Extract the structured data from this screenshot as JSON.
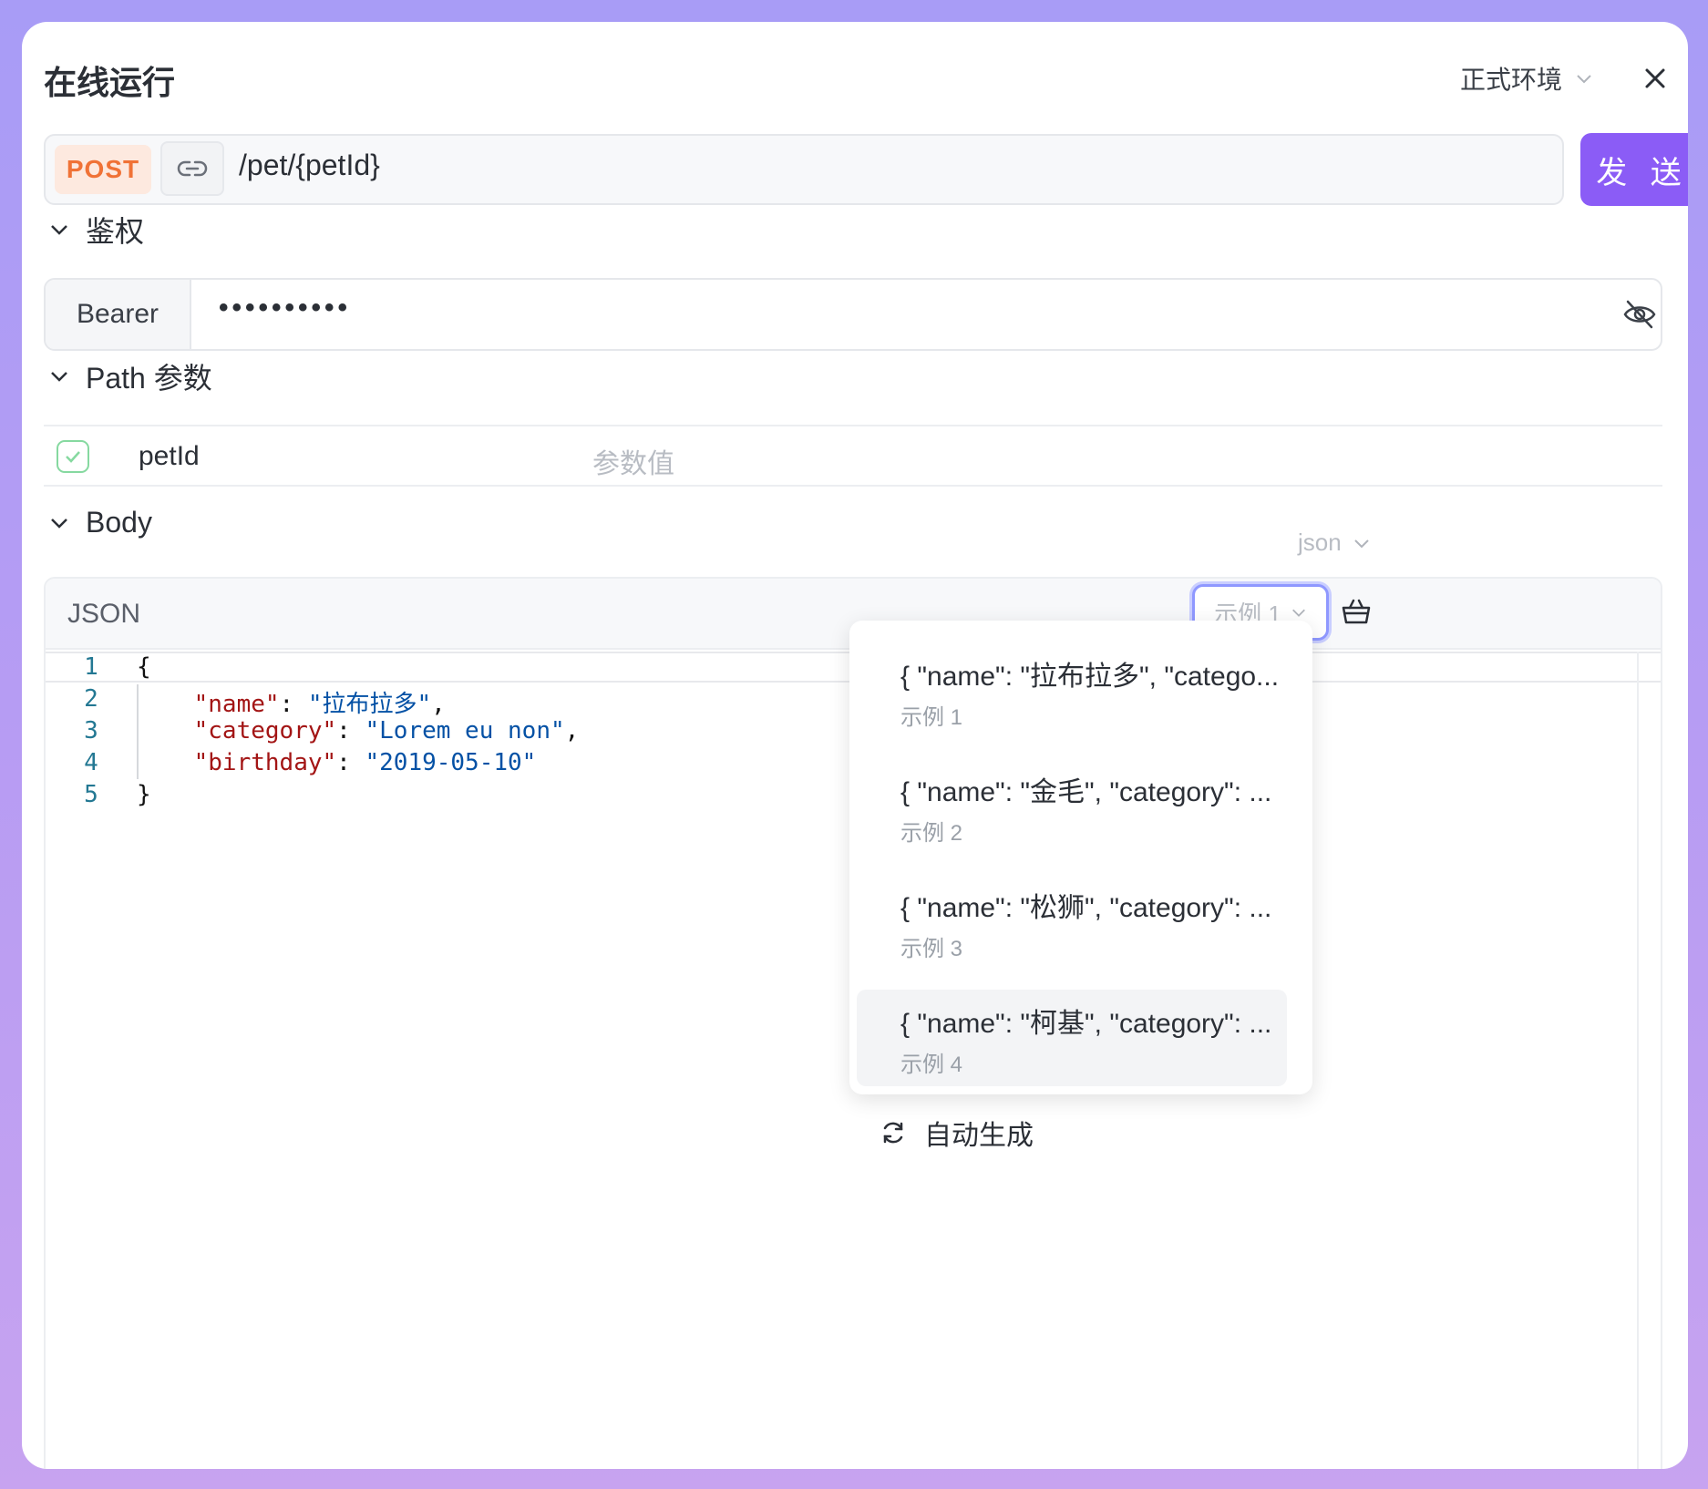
{
  "header": {
    "title": "在线运行",
    "env_label": "正式环境"
  },
  "request": {
    "method": "POST",
    "path": "/pet/{petId}",
    "send_label": "发 送"
  },
  "auth": {
    "section_title": "鉴权",
    "type": "Bearer",
    "token_masked": "••••••••••"
  },
  "path_params": {
    "section_title": "Path 参数",
    "rows": [
      {
        "name": "petId",
        "value_placeholder": "参数值"
      }
    ]
  },
  "body": {
    "section_title": "Body",
    "format": "json",
    "editor_label": "JSON",
    "example_selected": "示例 1",
    "line_numbers": [
      "1",
      "2",
      "3",
      "4",
      "5"
    ],
    "code": {
      "open": "{",
      "close": "}",
      "fields": [
        {
          "key": "\"name\"",
          "value": "\"拉布拉多\"",
          "trail": ","
        },
        {
          "key": "\"category\"",
          "value": "\"Lorem eu non\"",
          "trail": ","
        },
        {
          "key": "\"birthday\"",
          "value": "\"2019-05-10\"",
          "trail": ""
        }
      ]
    }
  },
  "examples_dropdown": {
    "items": [
      {
        "preview": "{ \"name\": \"拉布拉多\", \"catego...",
        "label": "示例 1"
      },
      {
        "preview": "{ \"name\": \"金毛\", \"category\": ...",
        "label": "示例 2"
      },
      {
        "preview": "{ \"name\": \"松狮\", \"category\": ...",
        "label": "示例 3"
      },
      {
        "preview": "{ \"name\": \"柯基\", \"category\": ...",
        "label": "示例 4"
      }
    ],
    "auto_generate": "自动生成"
  },
  "colors": {
    "accent": "#8b5cf6",
    "method": "#f07236",
    "json_key": "#a31515",
    "json_string": "#0451a5"
  }
}
